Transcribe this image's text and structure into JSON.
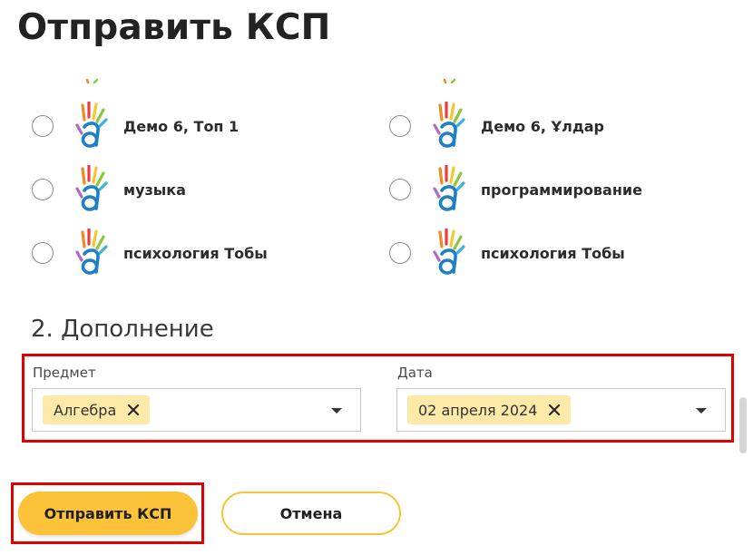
{
  "page": {
    "title": "Отправить КСП"
  },
  "classes": [
    {
      "label": "Демо 6, Топ 1",
      "selected": false,
      "logo": "hand-a-logo-icon"
    },
    {
      "label": "Демо 6, Ұлдар",
      "selected": false,
      "logo": "hand-a-logo-icon"
    },
    {
      "label": "музыка",
      "selected": false,
      "logo": "hand-a-logo-icon"
    },
    {
      "label": "программирование",
      "selected": false,
      "logo": "hand-a-logo-icon"
    },
    {
      "label": "психология Тобы",
      "selected": false,
      "logo": "hand-a-logo-icon"
    },
    {
      "label": "психология Тобы",
      "selected": false,
      "logo": "hand-a-logo-icon"
    }
  ],
  "addon": {
    "section_title": "2. Дополнение",
    "subject": {
      "label": "Предмет",
      "selected_chip": "Алгебра",
      "remove_icon": "close-icon",
      "dropdown_icon": "caret-down-icon"
    },
    "date": {
      "label": "Дата",
      "selected_chip": "02 апреля 2024",
      "remove_icon": "close-icon",
      "dropdown_icon": "caret-down-icon"
    }
  },
  "actions": {
    "submit_label": "Отправить КСП",
    "cancel_label": "Отмена"
  },
  "colors": {
    "accent_yellow": "#fcc23a",
    "chip_bg": "#fde9a8",
    "highlight_red": "#e00000",
    "logo_a_blue": "#1e7fc4"
  }
}
